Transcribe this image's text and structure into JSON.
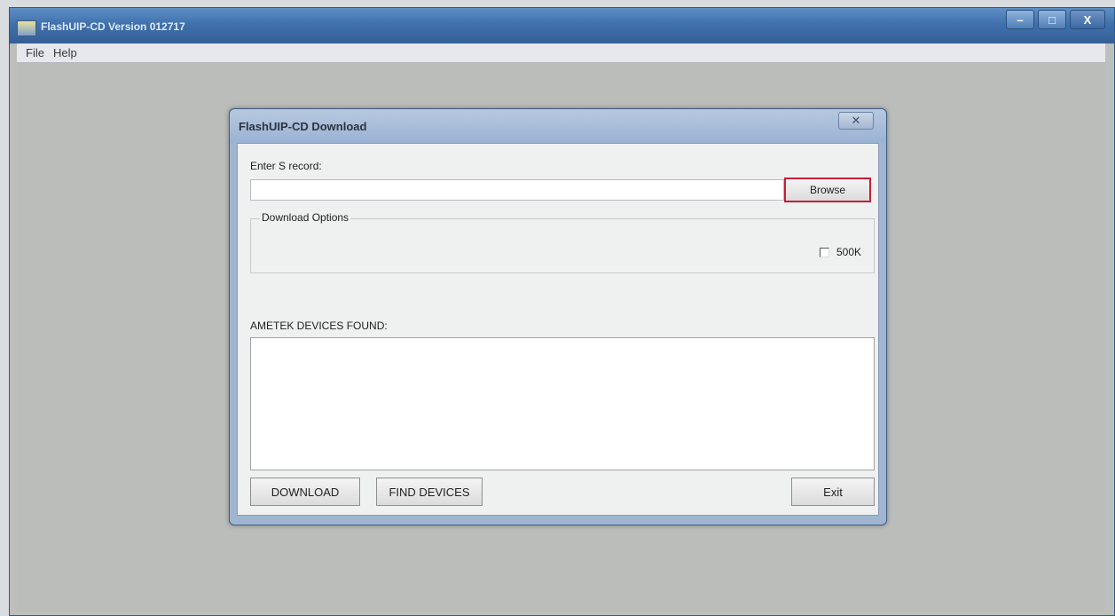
{
  "main_window": {
    "title": "FlashUIP-CD Version 012717",
    "controls": {
      "minimize": "–",
      "maximize": "□",
      "close": "X"
    }
  },
  "menu": {
    "items": [
      "File",
      "Help"
    ]
  },
  "dialog": {
    "title": "FlashUIP-CD Download",
    "close": "✕",
    "srecord_label": "Enter S record:",
    "srecord_value": "",
    "browse_label": "Browse",
    "download_options_title": "Download Options",
    "checkbox_500k": {
      "label": "500K",
      "checked": false
    },
    "devices_label": "AMETEK DEVICES FOUND:",
    "devices": [],
    "download_label": "DOWNLOAD",
    "find_devices_label": "FIND DEVICES",
    "exit_label": "Exit"
  },
  "colors": {
    "highlight": "#c41e3a",
    "titlebar": "#3f71ad"
  }
}
